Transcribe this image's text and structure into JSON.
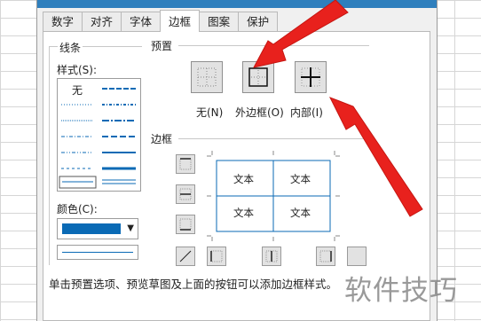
{
  "tabs": [
    {
      "label": "数字"
    },
    {
      "label": "对齐"
    },
    {
      "label": "字体"
    },
    {
      "label": "边框"
    },
    {
      "label": "图案"
    },
    {
      "label": "保护"
    }
  ],
  "active_tab": "边框",
  "line_group": {
    "title": "线条",
    "style_label": "样式(S):",
    "none_label": "无",
    "color_label": "颜色(C):",
    "color_value": "#0a6ab5"
  },
  "presets": {
    "title": "预置",
    "none_label": "无(N)",
    "outline_label": "外边框(O)",
    "inside_label": "内部(I)"
  },
  "border": {
    "title": "边框",
    "cells": [
      "文本",
      "文本",
      "文本",
      "文本"
    ]
  },
  "hint": "单击预置选项、预览草图及上面的按钮可以添加边框样式。",
  "watermark": "软件技巧",
  "colors": {
    "accent": "#0a6ab5",
    "arrow": "#e8211d",
    "title_bar": "#2f7fbd"
  }
}
